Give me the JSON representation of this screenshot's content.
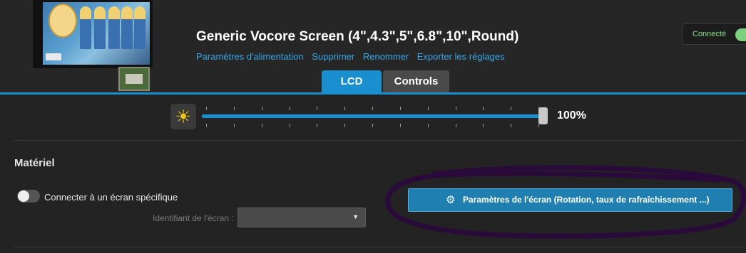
{
  "device": {
    "title": "Generic Vocore Screen (4\",4.3\",5\",6.8\",10\",Round)",
    "links": [
      "Paramètres d'alimentation",
      "Supprimer",
      "Renommer",
      "Exporter les réglages"
    ],
    "status_label": "Connecté",
    "connected": true
  },
  "tabs": [
    {
      "label": "LCD",
      "active": true
    },
    {
      "label": "Controls",
      "active": false
    }
  ],
  "brightness": {
    "icon": "sun-icon",
    "value_label": "100%",
    "value": 1.0
  },
  "hardware": {
    "section_title": "Matériel",
    "toggle_label": "Connecter à un écran spécifique",
    "toggle_on": false,
    "id_label": "Identifiant de l'écran :",
    "id_value": "",
    "settings_button": "Paramètres de l'écran (Rotation, taux de rafraîchissement ...)"
  },
  "colors": {
    "accent": "#1a8fd0",
    "background": "#232323",
    "connected": "#7fd07f",
    "annotation": "#2a0a3a"
  }
}
